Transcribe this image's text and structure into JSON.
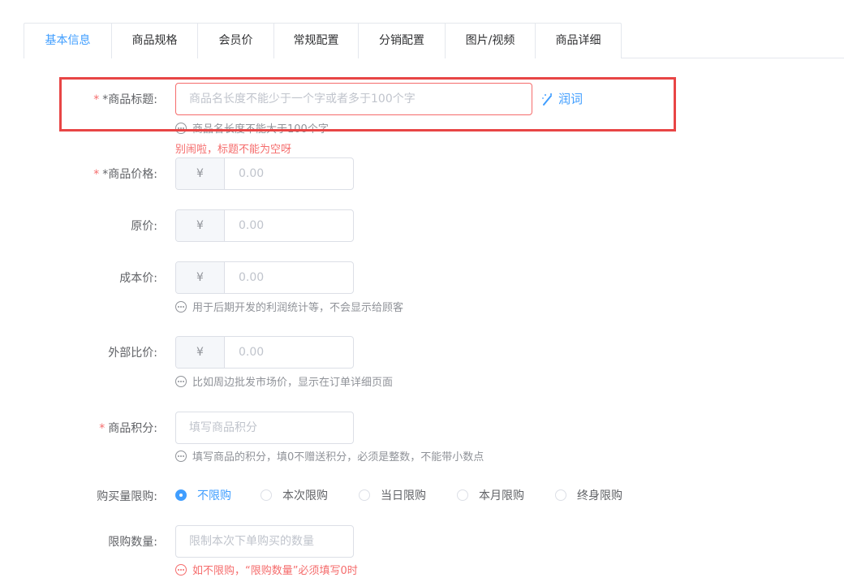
{
  "tabs": [
    {
      "label": "基本信息",
      "active": true
    },
    {
      "label": "商品规格"
    },
    {
      "label": "会员价"
    },
    {
      "label": "常规配置"
    },
    {
      "label": "分销配置"
    },
    {
      "label": "图片/视频"
    },
    {
      "label": "商品详细"
    }
  ],
  "form": {
    "title": {
      "required_mark": "*",
      "label": "*商品标题:",
      "placeholder": "商品名长度不能少于一个字或者多于100个字",
      "polish_label": "润词",
      "tip": "商品名长度不能大于100个字",
      "error": "别闹啦，标题不能为空呀"
    },
    "price": {
      "required_mark": "*",
      "label": "*商品价格:",
      "prefix": "¥",
      "placeholder": "0.00"
    },
    "original_price": {
      "label": "原价:",
      "prefix": "¥",
      "placeholder": "0.00"
    },
    "cost_price": {
      "label": "成本价:",
      "prefix": "¥",
      "placeholder": "0.00",
      "tip": "用于后期开发的利润统计等，不会显示给顾客"
    },
    "external_price": {
      "label": "外部比价:",
      "prefix": "¥",
      "placeholder": "0.00",
      "tip": "比如周边批发市场价，显示在订单详细页面"
    },
    "points": {
      "required_mark": "*",
      "label": "商品积分:",
      "placeholder": "填写商品积分",
      "tip": "填写商品的积分，填0不赠送积分，必须是整数，不能带小数点"
    },
    "purchase_limit": {
      "label": "购买量限购:",
      "options": [
        "不限购",
        "本次限购",
        "当日限购",
        "本月限购",
        "终身限购"
      ],
      "selected": "不限购"
    },
    "limit_quantity": {
      "label": "限购数量:",
      "placeholder": "限制本次下单购买的数量",
      "tip": "如不限购，“限购数量”必须填写0时"
    }
  },
  "colors": {
    "accent": "#409eff",
    "error": "#f56c6c",
    "highlight": "#e84545"
  }
}
